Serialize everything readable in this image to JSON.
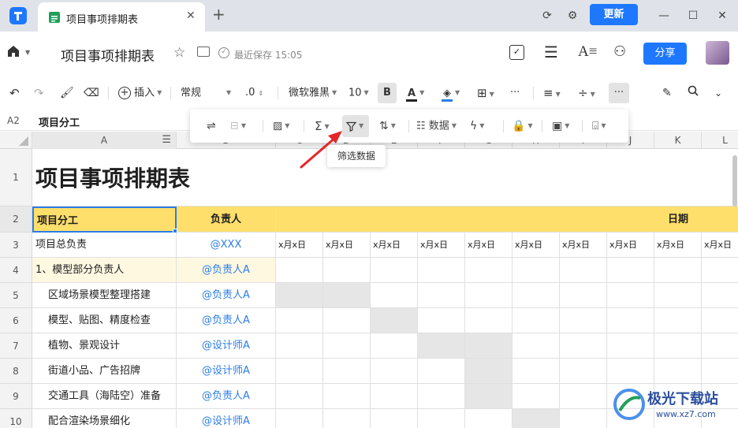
{
  "browser": {
    "tab_title": "项目事项排期表",
    "update_label": "更新"
  },
  "header": {
    "doc_title": "项目事项排期表",
    "save_status": "最近保存 15:05",
    "share_label": "分享"
  },
  "toolbar": {
    "insert_label": "插入",
    "format_value": "常规",
    "decimal_label": ".0",
    "font_family": "微软雅黑",
    "font_size": "10",
    "bold_label": "B",
    "text_color_label": "A",
    "more_label": "···"
  },
  "formula_bar": {
    "cell_ref": "A2",
    "content": "项目分工"
  },
  "float_toolbar": {
    "data_label": "数据",
    "tooltip": "筛选数据"
  },
  "columns": [
    "A",
    "B",
    "C",
    "D",
    "E",
    "F",
    "G",
    "H",
    "I",
    "J",
    "K",
    "L"
  ],
  "rows": {
    "numbers": [
      "1",
      "2",
      "3",
      "4",
      "5",
      "6",
      "7",
      "8",
      "9",
      "10"
    ],
    "title": "项目事项排期表",
    "header_a": "项目分工",
    "header_b": "负责人",
    "header_date": "日期",
    "date_cell": "x月x日",
    "items": [
      {
        "a": "项目总负责",
        "b": "@XXX"
      },
      {
        "a": "1、模型部分负责人",
        "b": "@负责人A"
      },
      {
        "a": "区域场景模型整理搭建",
        "b": "@负责人A"
      },
      {
        "a": "模型、贴图、精度检查",
        "b": "@负责人A"
      },
      {
        "a": "植物、景观设计",
        "b": "@设计师A"
      },
      {
        "a": "街道小品、广告招牌",
        "b": "@设计师A"
      },
      {
        "a": "交通工具（海陆空）准备",
        "b": "@负责人A"
      },
      {
        "a": "配合渲染场景细化",
        "b": "@设计师A"
      }
    ]
  },
  "watermark": {
    "brand": "极光下载站",
    "url": "www.xz7.com"
  },
  "colors": {
    "accent": "#1e78ff",
    "header_yellow": "#ffdf6b",
    "gantt_gray": "#e6e6e6",
    "link_blue": "#2b7de9",
    "arrow_red": "#e3262a"
  }
}
